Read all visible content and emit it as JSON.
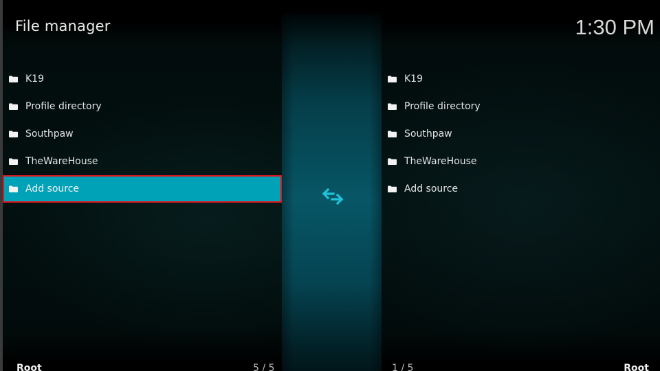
{
  "header": {
    "title": "File manager",
    "clock": "1:30 PM"
  },
  "left_pane": {
    "items": [
      {
        "label": "K19",
        "icon": "folder-icon"
      },
      {
        "label": "Profile directory",
        "icon": "folder-icon"
      },
      {
        "label": "Southpaw",
        "icon": "folder-icon"
      },
      {
        "label": "TheWareHouse",
        "icon": "folder-icon"
      },
      {
        "label": "Add source",
        "icon": "folder-icon",
        "selected": true
      }
    ],
    "path": "Root",
    "position": "5 / 5"
  },
  "right_pane": {
    "items": [
      {
        "label": "K19",
        "icon": "folder-icon"
      },
      {
        "label": "Profile directory",
        "icon": "folder-icon"
      },
      {
        "label": "Southpaw",
        "icon": "folder-icon"
      },
      {
        "label": "TheWareHouse",
        "icon": "folder-icon"
      },
      {
        "label": "Add source",
        "icon": "folder-icon"
      }
    ],
    "path": "Root",
    "position": "1 / 5"
  },
  "center": {
    "icon": "swap-arrows-icon"
  },
  "colors": {
    "accent": "#00a2b8",
    "focus_outline": "#e0141e",
    "swap_icon": "#1fc3dc"
  }
}
